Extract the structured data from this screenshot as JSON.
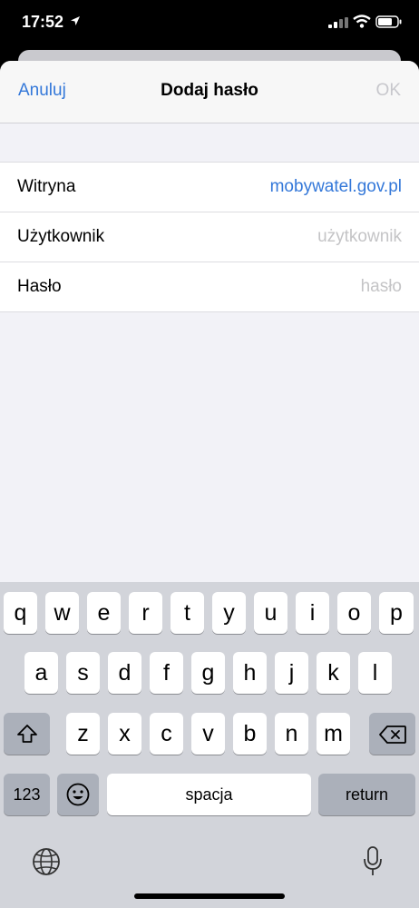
{
  "status_bar": {
    "time": "17:52"
  },
  "nav": {
    "cancel_label": "Anuluj",
    "title": "Dodaj hasło",
    "ok_label": "OK"
  },
  "form": {
    "rows": [
      {
        "label": "Witryna",
        "value": "mobywatel.gov.pl",
        "value_kind": "value"
      },
      {
        "label": "Użytkownik",
        "value": "użytkownik",
        "value_kind": "placeholder"
      },
      {
        "label": "Hasło",
        "value": "hasło",
        "value_kind": "placeholder"
      }
    ]
  },
  "keyboard": {
    "row1": [
      "q",
      "w",
      "e",
      "r",
      "t",
      "y",
      "u",
      "i",
      "o",
      "p"
    ],
    "row2": [
      "a",
      "s",
      "d",
      "f",
      "g",
      "h",
      "j",
      "k",
      "l"
    ],
    "row3": [
      "z",
      "x",
      "c",
      "v",
      "b",
      "n",
      "m"
    ],
    "numbers_label": "123",
    "space_label": "spacja",
    "return_label": "return",
    "icons": [
      "shift-icon",
      "backspace-icon",
      "emoji-icon",
      "globe-icon",
      "microphone-icon"
    ]
  },
  "colors": {
    "accent": "#3478d9",
    "placeholder": "#c4c4c6",
    "keyboard_bg": "#d2d4da"
  }
}
